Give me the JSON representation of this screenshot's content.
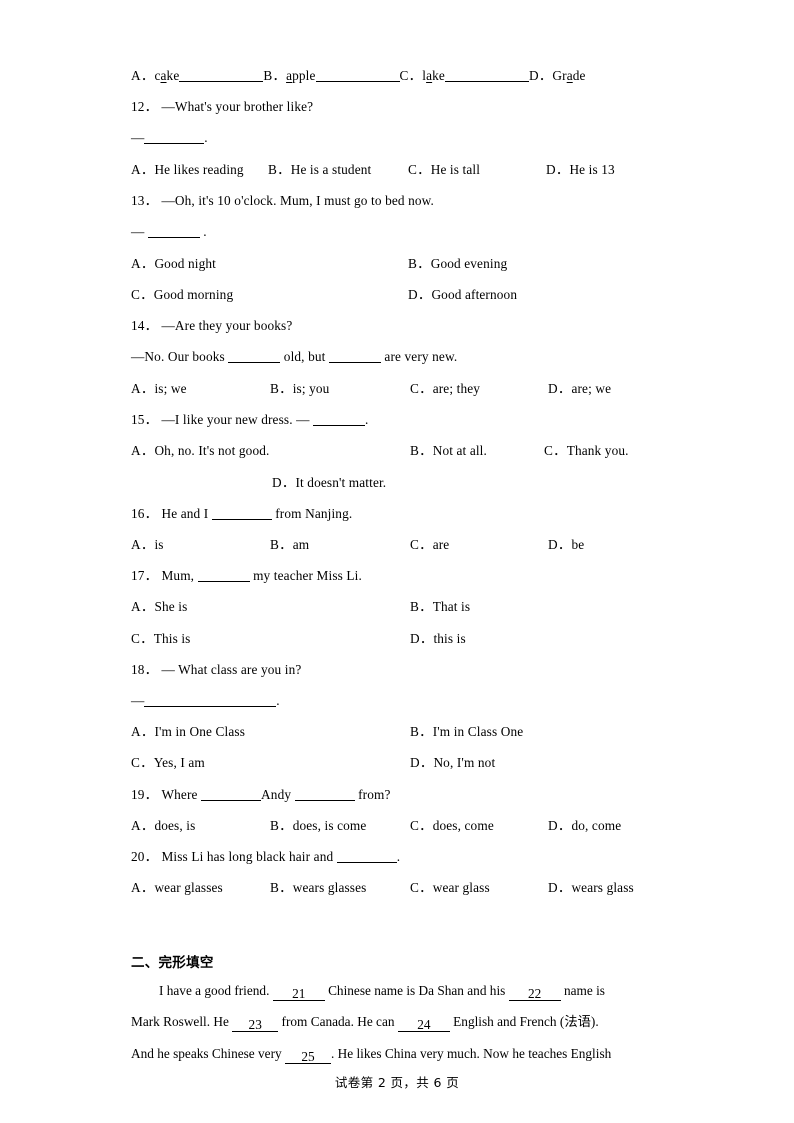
{
  "document": {
    "footer": "试卷第 2 页，共 6 页",
    "page_number": "2",
    "total_pages": "6"
  },
  "q11_options": {
    "a_letter": "A．",
    "a_pre": "c",
    "a_mid": "a",
    "a_post": "ke",
    "b_letter": "B．",
    "b_pre": "",
    "b_mid": "a",
    "b_post": "pple",
    "c_letter": "C．",
    "c_pre": "l",
    "c_mid": "a",
    "c_post": "ke",
    "d_letter": "D．",
    "d_pre": "Gr",
    "d_mid": "a",
    "d_post": "de"
  },
  "questions": [
    {
      "number": "12．",
      "stem": "—What's your brother like?",
      "answer_line_prefix": "—",
      "answer_line_suffix": ".",
      "options": [
        {
          "letter": "A．",
          "text": "He likes reading"
        },
        {
          "letter": "B．",
          "text": "He is a student"
        },
        {
          "letter": "C．",
          "text": "He is tall"
        },
        {
          "letter": "D．",
          "text": "He is 13"
        }
      ]
    },
    {
      "number": "13．",
      "stem": "—Oh, it's 10 o'clock. Mum, I must go to bed now.",
      "answer_line_prefix": "—",
      "answer_line_suffix": ".",
      "options": [
        {
          "letter": "A．",
          "text": "Good night"
        },
        {
          "letter": "B．",
          "text": "Good evening"
        },
        {
          "letter": "C．",
          "text": "Good morning"
        },
        {
          "letter": "D．",
          "text": "Good afternoon"
        }
      ]
    },
    {
      "number": "14．",
      "stem": "—Are they your books?",
      "answer_line_a": "—No. Our books",
      "answer_line_b": "old, but",
      "answer_line_c": "are very new.",
      "options": [
        {
          "letter": "A．",
          "text": "is; we"
        },
        {
          "letter": "B．",
          "text": "is; you"
        },
        {
          "letter": "C．",
          "text": "are; they"
        },
        {
          "letter": "D．",
          "text": "are; we"
        }
      ]
    },
    {
      "number": "15．",
      "stem_a": "—I like your new dress. —",
      "stem_b": ".",
      "options": [
        {
          "letter": "A．",
          "text": "Oh, no. It's not good."
        },
        {
          "letter": "B．",
          "text": "Not at all."
        },
        {
          "letter": "C．",
          "text": "Thank you."
        },
        {
          "letter": "D．",
          "text": "It doesn't matter."
        }
      ]
    },
    {
      "number": "16．",
      "stem_a": "He and I",
      "stem_b": "from Nanjing.",
      "options": [
        {
          "letter": "A．",
          "text": "is"
        },
        {
          "letter": "B．",
          "text": "am"
        },
        {
          "letter": "C．",
          "text": "are"
        },
        {
          "letter": "D．",
          "text": "be"
        }
      ]
    },
    {
      "number": "17．",
      "stem_a": "Mum,",
      "stem_b": "my teacher Miss Li.",
      "options": [
        {
          "letter": "A．",
          "text": "She is"
        },
        {
          "letter": "B．",
          "text": "That is"
        },
        {
          "letter": "C．",
          "text": "This is"
        },
        {
          "letter": "D．",
          "text": "this is"
        }
      ]
    },
    {
      "number": "18．",
      "stem": "— What class are you in?",
      "answer_line_prefix": "—",
      "answer_line_suffix": ".",
      "options": [
        {
          "letter": "A．",
          "text": "I'm in One Class"
        },
        {
          "letter": "B．",
          "text": "I'm in Class One"
        },
        {
          "letter": "C．",
          "text": "Yes, I am"
        },
        {
          "letter": "D．",
          "text": "No, I'm not"
        }
      ]
    },
    {
      "number": "19．",
      "stem_a": "Where",
      "stem_b": "Andy",
      "stem_c": "from?",
      "options": [
        {
          "letter": "A．",
          "text": "does, is"
        },
        {
          "letter": "B．",
          "text": "does, is come"
        },
        {
          "letter": "C．",
          "text": "does, come"
        },
        {
          "letter": "D．",
          "text": "do, come"
        }
      ]
    },
    {
      "number": "20．",
      "stem_a": "Miss Li has long black hair and",
      "stem_b": ".",
      "options": [
        {
          "letter": "A．",
          "text": "wear glasses"
        },
        {
          "letter": "B．",
          "text": "wears glasses"
        },
        {
          "letter": "C．",
          "text": "wear glass"
        },
        {
          "letter": "D．",
          "text": "wears glass"
        }
      ]
    }
  ],
  "cloze": {
    "heading": "二、完形填空",
    "line1_a": "I have a good friend.",
    "line1_blank": "21",
    "line1_b": "Chinese name is Da Shan and his",
    "line1_blank2": "22",
    "line1_c": "name is",
    "line2_a": "Mark Roswell. He",
    "line2_blank": "23",
    "line2_b": "from Canada. He can",
    "line2_blank2": "24",
    "line2_c": "English and French (法语).",
    "line3_a": "And he speaks Chinese very",
    "line3_blank": "25",
    "line3_b": ". He likes China very much. Now he teaches English"
  }
}
